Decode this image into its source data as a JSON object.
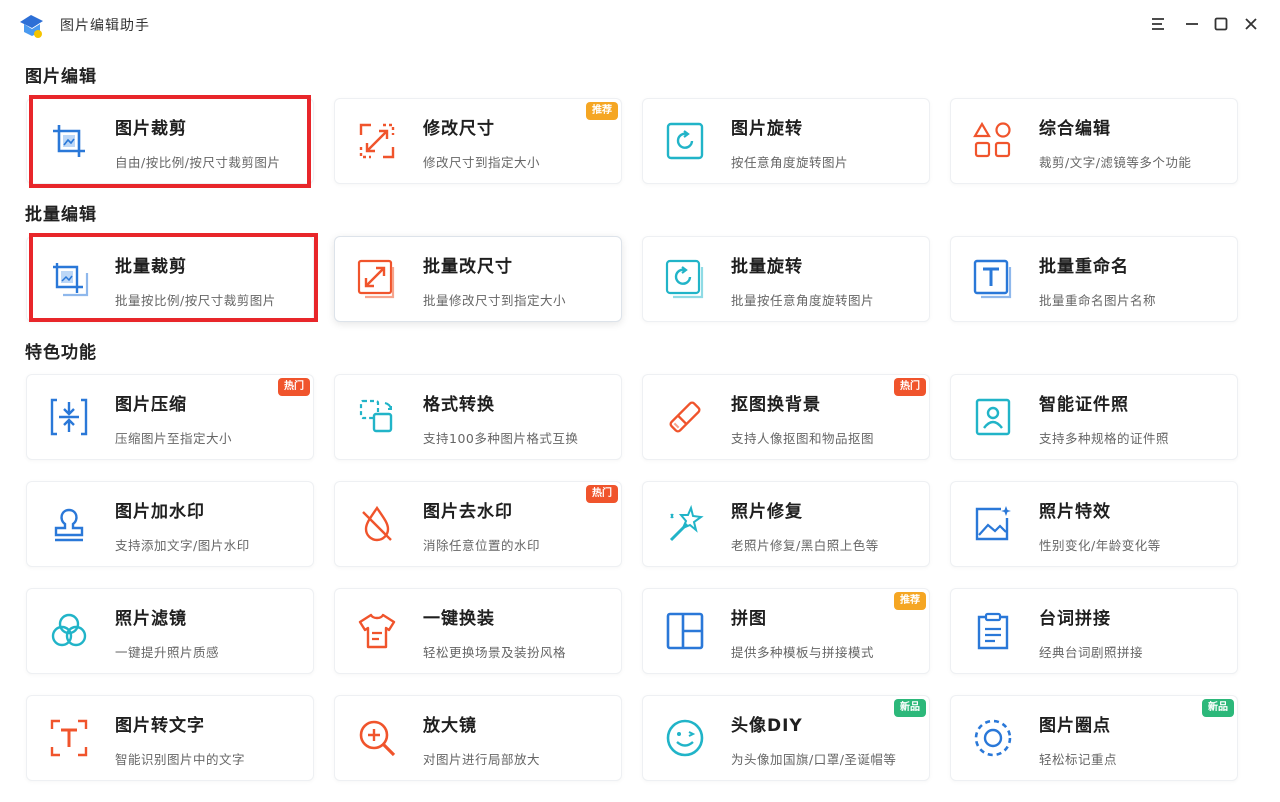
{
  "app": {
    "title": "图片编辑助手"
  },
  "colors": {
    "accent_blue": "#2a78d8",
    "accent_orange": "#f0542c",
    "accent_teal": "#21b4c8",
    "highlight_red": "#e8262a",
    "badge_orange": "#f5a623",
    "badge_red": "#f0542c",
    "badge_green": "#2cb87a"
  },
  "sections": [
    {
      "title": "图片编辑"
    },
    {
      "title": "批量编辑"
    },
    {
      "title": "特色功能"
    }
  ],
  "cards": [
    {
      "title": "图片裁剪",
      "desc": "自由/按比例/按尺寸裁剪图片",
      "icon": "crop-icon",
      "badge": ""
    },
    {
      "title": "修改尺寸",
      "desc": "修改尺寸到指定大小",
      "icon": "resize-icon",
      "badge": "推荐"
    },
    {
      "title": "图片旋转",
      "desc": "按任意角度旋转图片",
      "icon": "rotate-icon",
      "badge": ""
    },
    {
      "title": "综合编辑",
      "desc": "裁剪/文字/滤镜等多个功能",
      "icon": "shapes-icon",
      "badge": ""
    },
    {
      "title": "批量裁剪",
      "desc": "批量按比例/按尺寸裁剪图片",
      "icon": "batch-crop-icon",
      "badge": ""
    },
    {
      "title": "批量改尺寸",
      "desc": "批量修改尺寸到指定大小",
      "icon": "batch-resize-icon",
      "badge": ""
    },
    {
      "title": "批量旋转",
      "desc": "批量按任意角度旋转图片",
      "icon": "batch-rotate-icon",
      "badge": ""
    },
    {
      "title": "批量重命名",
      "desc": "批量重命名图片名称",
      "icon": "batch-rename-icon",
      "badge": ""
    },
    {
      "title": "图片压缩",
      "desc": "压缩图片至指定大小",
      "icon": "compress-icon",
      "badge": "热门"
    },
    {
      "title": "格式转换",
      "desc": "支持100多种图片格式互换",
      "icon": "format-convert-icon",
      "badge": ""
    },
    {
      "title": "抠图换背景",
      "desc": "支持人像抠图和物品抠图",
      "icon": "eraser-icon",
      "badge": "热门"
    },
    {
      "title": "智能证件照",
      "desc": "支持多种规格的证件照",
      "icon": "id-photo-icon",
      "badge": ""
    },
    {
      "title": "图片加水印",
      "desc": "支持添加文字/图片水印",
      "icon": "stamp-icon",
      "badge": ""
    },
    {
      "title": "图片去水印",
      "desc": "消除任意位置的水印",
      "icon": "no-drop-icon",
      "badge": "热门"
    },
    {
      "title": "照片修复",
      "desc": "老照片修复/黑白照上色等",
      "icon": "magic-wand-icon",
      "badge": ""
    },
    {
      "title": "照片特效",
      "desc": "性别变化/年龄变化等",
      "icon": "image-sparkle-icon",
      "badge": ""
    },
    {
      "title": "照片滤镜",
      "desc": "一键提升照片质感",
      "icon": "filter-icon",
      "badge": ""
    },
    {
      "title": "一键换装",
      "desc": "轻松更换场景及装扮风格",
      "icon": "shirt-icon",
      "badge": ""
    },
    {
      "title": "拼图",
      "desc": "提供多种模板与拼接模式",
      "icon": "collage-icon",
      "badge": "推荐"
    },
    {
      "title": "台词拼接",
      "desc": "经典台词剧照拼接",
      "icon": "clipboard-icon",
      "badge": ""
    },
    {
      "title": "图片转文字",
      "desc": "智能识别图片中的文字",
      "icon": "text-recognition-icon",
      "badge": ""
    },
    {
      "title": "放大镜",
      "desc": "对图片进行局部放大",
      "icon": "magnifier-icon",
      "badge": ""
    },
    {
      "title": "头像DIY",
      "desc": "为头像加国旗/口罩/圣诞帽等",
      "icon": "smiley-icon",
      "badge": "新品"
    },
    {
      "title": "图片圈点",
      "desc": "轻松标记重点",
      "icon": "circle-mark-icon",
      "badge": "新品"
    }
  ]
}
